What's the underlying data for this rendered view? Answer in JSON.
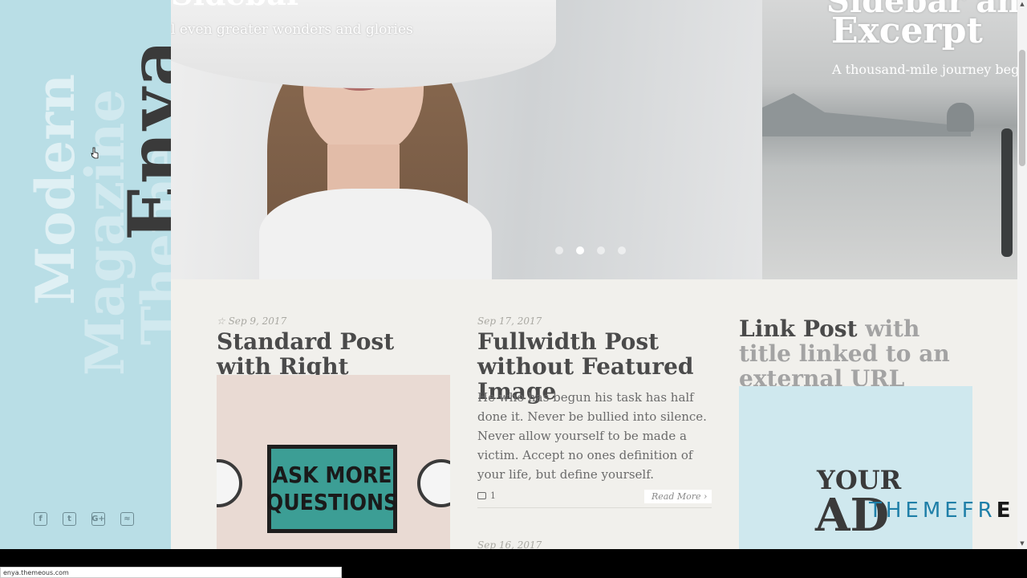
{
  "sidebar": {
    "tagline_1": "Modern",
    "tagline_2": "Magazine",
    "tagline_3": "Theme",
    "brand": "Enya",
    "social": [
      {
        "icon": "facebook-icon",
        "glyph": "f"
      },
      {
        "icon": "twitter-icon",
        "glyph": "t"
      },
      {
        "icon": "google-plus-icon",
        "glyph": "G+"
      },
      {
        "icon": "rss-icon",
        "glyph": "≈"
      }
    ]
  },
  "slider": {
    "slide_a_title": "Sidebar",
    "slide_a_text": "l even greater wonders and glories",
    "slide_b_title_1": "Sidebar and",
    "slide_b_title_2": "Excerpt",
    "slide_b_text": "A thousand-mile journey begi",
    "dots": 4,
    "active_dot": 2
  },
  "posts": [
    {
      "date": "Sep 9, 2017",
      "title": "Standard Post with Right Sidebar",
      "image_text": [
        "ASK MORE",
        "QUESTIONS"
      ]
    },
    {
      "date": "Sep 17, 2017",
      "title": "Fullwidth Post without Featured Image",
      "text": "He who has begun his task has half done it. Never be bullied into silence. Never allow yourself to be made a victim. Accept no ones definition of your life, but define yourself.",
      "comments": "1",
      "read_more": "Read More",
      "next_date": "Sep 16, 2017"
    },
    {
      "title_link": "Link Post",
      "title_rest": "with title linked to an external URL",
      "ad_your": "YOUR",
      "ad_ad": "AD",
      "ad_brand": "THEMEFR",
      "ad_brand_tail": "E"
    }
  ],
  "status_url": "enya.themeous.com",
  "colors": {
    "sidebar_bg": "#b9dee6",
    "content_bg": "#f1f0ec",
    "title": "#4a4a4a"
  }
}
